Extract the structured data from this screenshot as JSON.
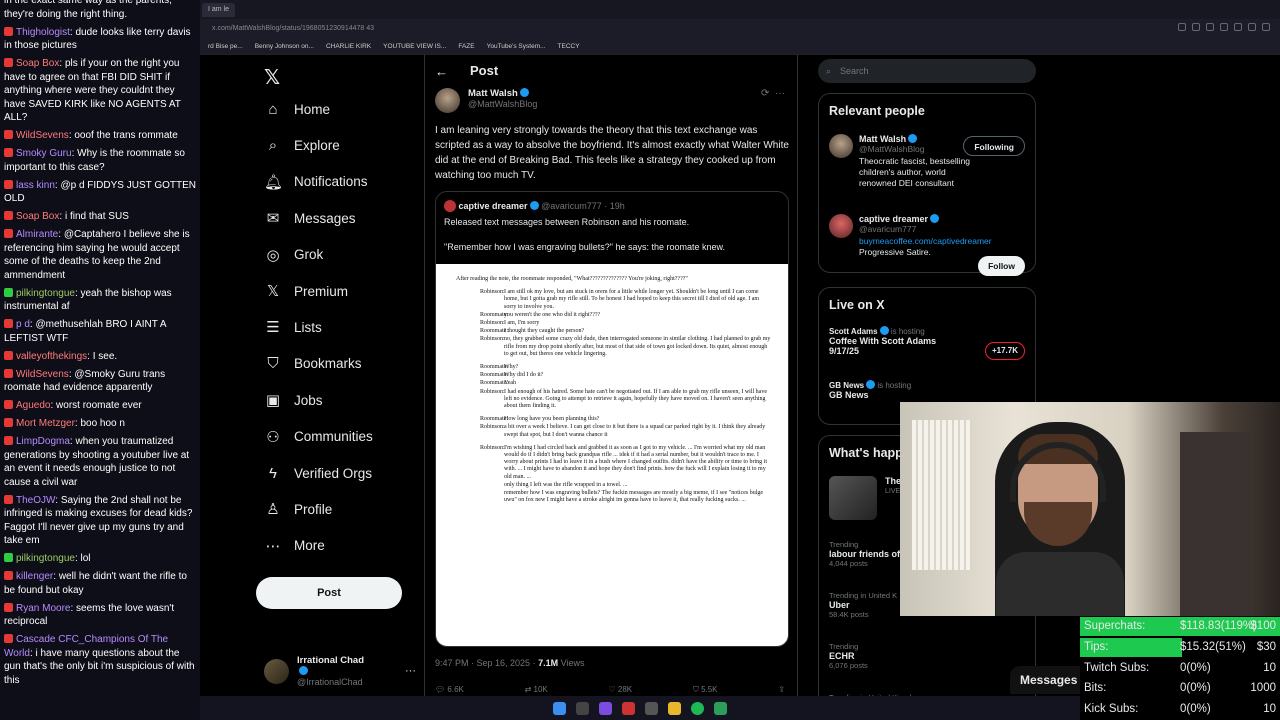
{
  "chat": [
    {
      "user": "",
      "color": "#ff6b6b",
      "badge": "",
      "text": "in the exact same way as the parents, they're doing the right thing."
    },
    {
      "user": "Thighologist",
      "color": "#b48cff",
      "badge": "red",
      "text": "dude looks like terry davis in those pictures"
    },
    {
      "user": "Soap Box",
      "color": "#ff7b7b",
      "badge": "red",
      "text": "pls if your on the right you have to agree on that FBI DID SHIT if anything where were they couldnt they have SAVED KIRK like NO AGENTS AT ALL?"
    },
    {
      "user": "WildSevens",
      "color": "#ff7b7b",
      "badge": "red",
      "text": "ooof the trans rommate"
    },
    {
      "user": "Smoky Guru",
      "color": "#b48cff",
      "badge": "red",
      "text": "Why is the roommate so important to this case?"
    },
    {
      "user": "lass kinn",
      "color": "#b48cff",
      "badge": "red",
      "text": "@p d FIDDYS JUST GOTTEN OLD"
    },
    {
      "user": "Soap Box",
      "color": "#ff7b7b",
      "badge": "red",
      "text": "i find that SUS"
    },
    {
      "user": "Almirante",
      "color": "#b48cff",
      "badge": "red",
      "text": "@Captahero I believe she is referencing him saying he would accept some of the deaths to keep the 2nd ammendment"
    },
    {
      "user": "pilkingtongue",
      "color": "#9ccc65",
      "badge": "green",
      "text": "yeah the bishop was instrumental af"
    },
    {
      "user": "p d",
      "color": "#b48cff",
      "badge": "red",
      "text": "@methusehlah BRO I AINT A LEFTIST WTF"
    },
    {
      "user": "valleyofthekings",
      "color": "#ff7b7b",
      "badge": "red",
      "text": "I see."
    },
    {
      "user": "WildSevens",
      "color": "#ff7b7b",
      "badge": "red",
      "text": "@Smoky Guru trans roomate had evidence apparently"
    },
    {
      "user": "Aguedo",
      "color": "#ff7b7b",
      "badge": "red",
      "text": "worst roomate ever"
    },
    {
      "user": "Mort Metzger",
      "color": "#ff7b7b",
      "badge": "red",
      "text": "boo hoo n"
    },
    {
      "user": "LimpDogma",
      "color": "#b48cff",
      "badge": "red",
      "text": "when you traumatized generations by shooting a youtuber live at an event it needs enough justice to not cause a civil war"
    },
    {
      "user": "TheOJW",
      "color": "#b48cff",
      "badge": "red",
      "text": "Saying the 2nd shall not be infringed is making excuses for dead kids? Faggot I'll never give up my guns try and take em"
    },
    {
      "user": "pilkingtongue",
      "color": "#9ccc65",
      "badge": "green",
      "text": "lol"
    },
    {
      "user": "killenger",
      "color": "#b48cff",
      "badge": "red",
      "text": "well he didn't want the rifle to be found but okay"
    },
    {
      "user": "Ryan Moore",
      "color": "#b48cff",
      "badge": "red",
      "text": "seems the love wasn't reciprocal"
    },
    {
      "user": "Cascade CFC_Champions Of The World",
      "color": "#b48cff",
      "badge": "red",
      "text": "i have many questions about the gun that's the only bit i'm suspicious of with this"
    }
  ],
  "browser": {
    "tab": "I am le",
    "url": "x.com/MattWalshBlog/status/1968051230914478 43",
    "bookmarks": [
      "rd Bise pe...",
      "Benny Johnson on...",
      "CHARLIE KIRK",
      "YOUTUBE VIEW IS...",
      "FAZE",
      "YouTube's System...",
      "TECCY"
    ]
  },
  "nav": {
    "items": [
      "Home",
      "Explore",
      "Notifications",
      "Messages",
      "Grok",
      "Premium",
      "Lists",
      "Bookmarks",
      "Jobs",
      "Communities",
      "Verified Orgs",
      "Profile",
      "More"
    ],
    "post_button": "Post",
    "account_name": "Irrational Chad",
    "account_handle": "@IrrationalChad"
  },
  "post": {
    "header": "Post",
    "author_name": "Matt Walsh",
    "author_handle": "@MattWalshBlog",
    "text": "I am leaning very strongly towards the theory that this text exchange was scripted as a way to absolve the boyfriend. It's almost exactly what Walter White did at the end of Breaking Bad. This feels like a strategy they cooked up from watching too much TV.",
    "quote_name": "captive dreamer",
    "quote_handle": "@avaricum777 · 19h",
    "quote_line1": "Released text messages between Robinson and his roomate.",
    "quote_line2": "\"Remember how I was engraving bullets?\" he says: the roomate knew.",
    "doc_intro": "After reading the note, the roommate responded, \"What?????????????? You're joking, right????\"",
    "doc_rows": [
      {
        "s": "Robinson:",
        "t": "I am still ok my love, but am stuck in orem for a little while longer yet. Shouldn't be long until I can come home, but I gotta grab my rifle still. To be honest I had hoped to keep this secret till I died of old age. I am sorry to involve you."
      },
      {
        "s": "Roommate:",
        "t": "you weren't the one who did it right????"
      },
      {
        "s": "Robinson:",
        "t": "I am, I'm sorry"
      },
      {
        "s": "Roommate:",
        "t": "I thought they caught the person?"
      },
      {
        "s": "Robinson:",
        "t": "no, they grabbed some crazy old dude, then interrogated someone in similar clothing. I had planned to grab my rifle from my drop point shortly after, but most of that side of town got locked down. Its quiet, almost enough to get out, but theres one vehicle lingering."
      },
      {
        "s": "",
        "t": ""
      },
      {
        "s": "Roommate:",
        "t": "Why?"
      },
      {
        "s": "Roommate:",
        "t": "Why did I do it?"
      },
      {
        "s": "Roommate:",
        "t": "Yeah"
      },
      {
        "s": "Robinson:",
        "t": "I had enough of his hatred. Some hate can't be negotiated out. If I am able to grab my rifle unseen, I will have left no evidence. Going to attempt to retrieve it again, hopefully they have moved on. I haven't seen anything about them finding it."
      },
      {
        "s": "",
        "t": ""
      },
      {
        "s": "Roommate:",
        "t": "How long have you been planning this?"
      },
      {
        "s": "Robinson:",
        "t": "a bit over a week I believe. I can get close to it but there is a squad car parked right by it. I think they already swept that spot, but I don't wanna chance it"
      },
      {
        "s": "",
        "t": ""
      },
      {
        "s": "Robinson:",
        "t": "I'm wishing I had circled back and grabbed it as soon as I got to my vehicle. ... I'm worried what my old man would do if I didn't bring back grandpas rifle ... idek if it had a serial number, but it wouldn't trace to me. I worry about prints I had to leave it in a bush where I changed outfits. didn't have the ability or time to bring it with. ... I might have to abandon it and hope they don't find prints. how the fuck will I explain losing it to my old man. ..."
      },
      {
        "s": "",
        "t": "only thing I left was the rifle wrapped in a towel. ..."
      },
      {
        "s": "",
        "t": "remember how I was engraving bullets? The fuckin messages are mostly a big meme, if I see \"notices bulge uwu\" on fox new I might have a stroke alright im gonna have to leave it, that really fucking sucks. ..."
      }
    ],
    "time": "9:47 PM · Sep 16, 2025 ·",
    "views": "7.1M",
    "views_label": "Views",
    "actions": [
      "6.6K",
      "10K",
      "28K",
      "5.5K"
    ]
  },
  "right": {
    "search_placeholder": "Search",
    "relevant_title": "Relevant people",
    "person1": {
      "name": "Matt Walsh",
      "handle": "@MattWalshBlog",
      "bio": "Theocratic fascist, bestselling children's author, world renowned DEI consultant",
      "button": "Following"
    },
    "person2": {
      "name": "captive dreamer",
      "handle": "@avaricum777",
      "link": "buymeacoffee.com/captivedreamer",
      "bio": "Progressive Satire.",
      "button": "Follow"
    },
    "live_title": "Live on X",
    "live1": {
      "host": "Scott Adams",
      "hosting": "is hosting",
      "title": "Coffee With Scott Adams 9/17/25",
      "count": "+17.7K"
    },
    "live2": {
      "host": "GB News",
      "hosting": "is hosting",
      "title": "GB News"
    },
    "happening_title": "What's happ",
    "news_title": "The",
    "news_sub": "LIVE",
    "trends": [
      {
        "c": "Trending",
        "t": "labour friends of",
        "n": "4,044 posts"
      },
      {
        "c": "Trending in United K",
        "t": "Uber",
        "n": "58.4K posts"
      },
      {
        "c": "Trending",
        "t": "ECHR",
        "n": "6,076 posts"
      },
      {
        "c": "Trending in United Kingdom",
        "t": "",
        "n": ""
      }
    ],
    "messages": "Messages"
  },
  "stats": [
    {
      "l": "Superchats:",
      "m": "$118.83(119%)",
      "r": "$100",
      "fill": 1.0
    },
    {
      "l": "Tips:",
      "m": "$15.32(51%)",
      "r": "$30",
      "fill": 0.51
    },
    {
      "l": "Twitch Subs:",
      "m": "0(0%)",
      "r": "10",
      "fill": 0
    },
    {
      "l": "Bits:",
      "m": "0(0%)",
      "r": "1000",
      "fill": 0
    },
    {
      "l": "Kick Subs:",
      "m": "0(0%)",
      "r": "10",
      "fill": 0
    }
  ]
}
